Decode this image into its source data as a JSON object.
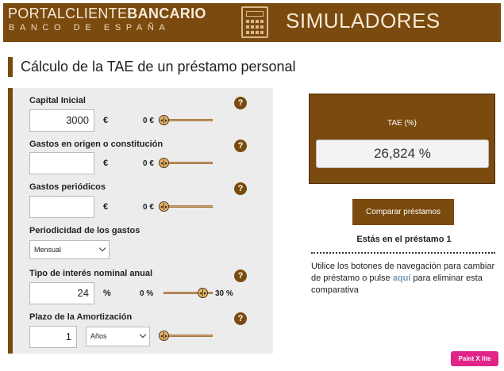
{
  "header": {
    "brand_thin": "PORTAL",
    "brand_mid": "CLIENTE",
    "brand_bold": "BANCARIO",
    "brand_sub": "BANCO DE ESPAÑA",
    "section_title": "SIMULADORES",
    "icon": "calculator-icon"
  },
  "page": {
    "title": "Cálculo de la TAE de un préstamo personal"
  },
  "form": {
    "capital": {
      "label": "Capital Inicial",
      "value": "3000",
      "unit": "€",
      "min_label": "0 €",
      "slider_level": 0
    },
    "gastos_origen": {
      "label": "Gastos en origen o constitución",
      "value": "",
      "unit": "€",
      "min_label": "0 €",
      "slider_level": 0
    },
    "gastos_periodicos": {
      "label": "Gastos periódicos",
      "value": "",
      "unit": "€",
      "min_label": "0 €",
      "slider_level": 0
    },
    "periodicidad": {
      "label": "Periodicidad de los gastos",
      "selected": "Mensual"
    },
    "interes": {
      "label": "Tipo de interés nominal anual",
      "value": "24",
      "unit": "%",
      "min_label": "0 %",
      "max_label": "30 %",
      "slider_level": 0.8
    },
    "plazo": {
      "label": "Plazo de la Amortización",
      "value": "1",
      "unit_selected": "Años",
      "slider_level": 0
    },
    "help_glyph": "?"
  },
  "result": {
    "label": "TAE (%)",
    "value": "26,824 %"
  },
  "compare": {
    "button_label": "Comparar préstamos",
    "current_loan": "Estás en el préstamo 1",
    "info_before": "Utilice los botones de navegación para cambiar de préstamo o pulse ",
    "info_link": "aquí",
    "info_after": " para eliminar esta comparativa"
  },
  "badge": {
    "label": "Paint X lite"
  },
  "colors": {
    "brand_brown": "#7a4a0f",
    "panel_gray": "#ececec",
    "link_blue": "#7a9bb8",
    "badge_pink": "#e0248a"
  }
}
